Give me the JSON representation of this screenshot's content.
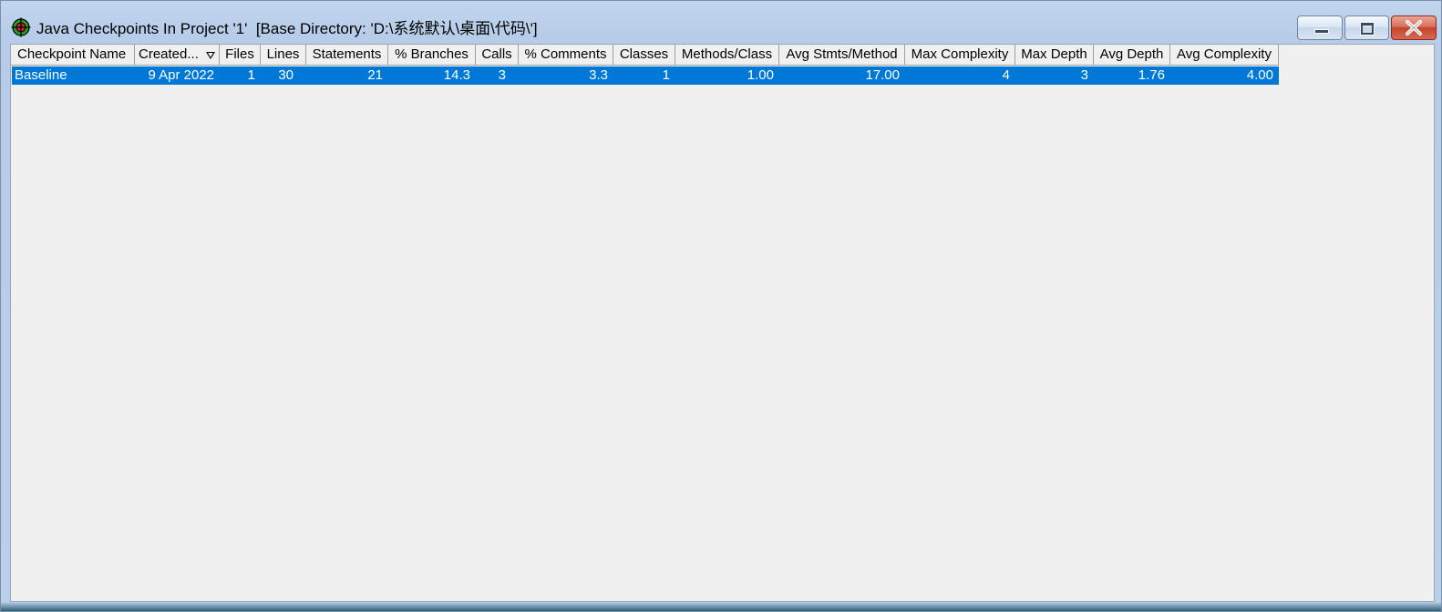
{
  "window": {
    "title": "Java Checkpoints In Project '1'  [Base Directory: 'D:\\系统默认\\桌面\\代码\\']",
    "icon": "target-crosshair-icon",
    "buttons": {
      "minimize": "minimize-icon",
      "maximize": "restore-icon",
      "close": "close-icon"
    },
    "colors": {
      "selection": "#0078d7",
      "close_button": "#c3442c"
    }
  },
  "table": {
    "columns": [
      {
        "label": "Checkpoint Name"
      },
      {
        "label": "Created..."
      },
      {
        "label": "Files"
      },
      {
        "label": "Lines"
      },
      {
        "label": "Statements"
      },
      {
        "label": "% Branches"
      },
      {
        "label": "Calls"
      },
      {
        "label": "% Comments"
      },
      {
        "label": "Classes"
      },
      {
        "label": "Methods/Class"
      },
      {
        "label": "Avg Stmts/Method"
      },
      {
        "label": "Max Complexity"
      },
      {
        "label": "Max Depth"
      },
      {
        "label": "Avg Depth"
      },
      {
        "label": "Avg Complexity"
      }
    ],
    "sorted_column": "Created...",
    "rows": [
      {
        "selected": true,
        "cells": [
          "Baseline",
          "9 Apr 2022",
          "1",
          "30",
          "21",
          "14.3",
          "3",
          "3.3",
          "1",
          "1.00",
          "17.00",
          "4",
          "3",
          "1.76",
          "4.00"
        ]
      }
    ]
  }
}
